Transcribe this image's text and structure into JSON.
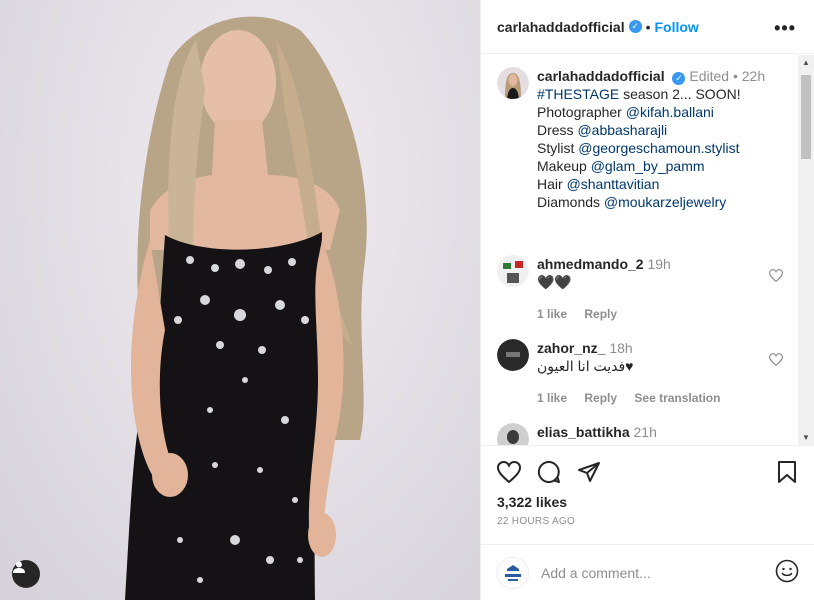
{
  "post": {
    "username": "carlahaddadofficial",
    "follow_label": "Follow",
    "more_label": "•••",
    "separator": "•"
  },
  "caption": {
    "username": "carlahaddadofficial",
    "edited": "Edited",
    "time": "22h",
    "lines": [
      {
        "text": "",
        "link": "#THESTAGE",
        "suffix": " season 2... SOON!"
      },
      {
        "text": "Photographer ",
        "link": "@kifah.ballani",
        "suffix": ""
      },
      {
        "text": "Dress ",
        "link": "@abbasharajli",
        "suffix": ""
      },
      {
        "text": "Stylist ",
        "link": "@georgeschamoun.stylist",
        "suffix": ""
      },
      {
        "text": "Makeup ",
        "link": "@glam_by_pamm",
        "suffix": ""
      },
      {
        "text": "Hair ",
        "link": "@shanttavitian",
        "suffix": ""
      },
      {
        "text": "Diamonds ",
        "link": "@moukarzeljewelry",
        "suffix": ""
      }
    ]
  },
  "comments": [
    {
      "username": "ahmedmando_2",
      "time": "19h",
      "text": "🖤🖤",
      "likes": "1 like",
      "reply": "Reply",
      "translate": ""
    },
    {
      "username": "zahor_nz_",
      "time": "18h",
      "text": "فديت انا العيون♥",
      "likes": "1 like",
      "reply": "Reply",
      "translate": "See translation"
    },
    {
      "username": "elias_battikha",
      "time": "21h",
      "text": "",
      "likes": "",
      "reply": "",
      "translate": ""
    }
  ],
  "stats": {
    "likes": "3,322 likes",
    "timestamp": "22 HOURS AGO"
  },
  "comment_input": {
    "placeholder": "Add a comment..."
  },
  "colors": {
    "accent": "#0095f6",
    "link": "#00376b",
    "muted": "#8e8e8e",
    "text": "#262626"
  },
  "icons": [
    "user-tag-icon",
    "like-heart-icon",
    "comment-icon",
    "share-icon",
    "save-icon",
    "emoji-icon",
    "verified-icon",
    "more-options-icon"
  ]
}
